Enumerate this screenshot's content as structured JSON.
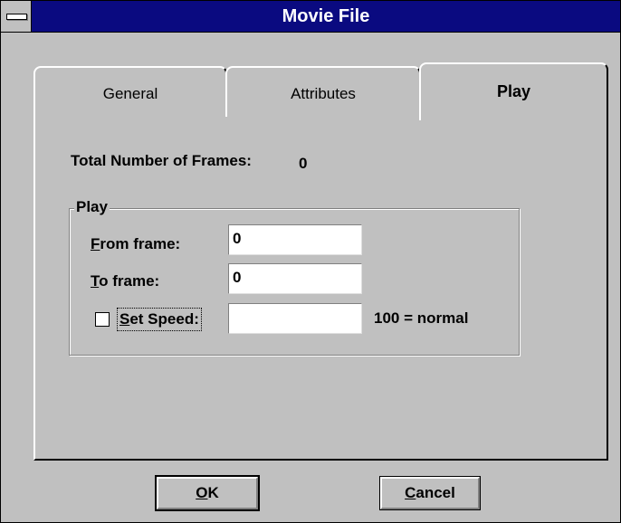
{
  "window": {
    "title": "Movie File"
  },
  "tabs": [
    {
      "label": "General",
      "selected": false
    },
    {
      "label": "Attributes",
      "selected": false
    },
    {
      "label": "Play",
      "selected": true
    }
  ],
  "play_tab": {
    "total_frames_label": "Total Number of Frames:",
    "total_frames_value": "0",
    "group_title": "Play",
    "from_frame": {
      "label_u": "F",
      "label_rest": "rom frame:",
      "value": "0"
    },
    "to_frame": {
      "label_u": "T",
      "label_rest": "o frame:",
      "value": "0"
    },
    "set_speed": {
      "label_u": "S",
      "label_rest": "et Speed:",
      "checked": false,
      "value": "",
      "hint": "100 = normal"
    }
  },
  "buttons": {
    "ok": {
      "label_u": "O",
      "label_rest": "K"
    },
    "cancel": {
      "label_u": "C",
      "label_rest": "ancel"
    }
  }
}
